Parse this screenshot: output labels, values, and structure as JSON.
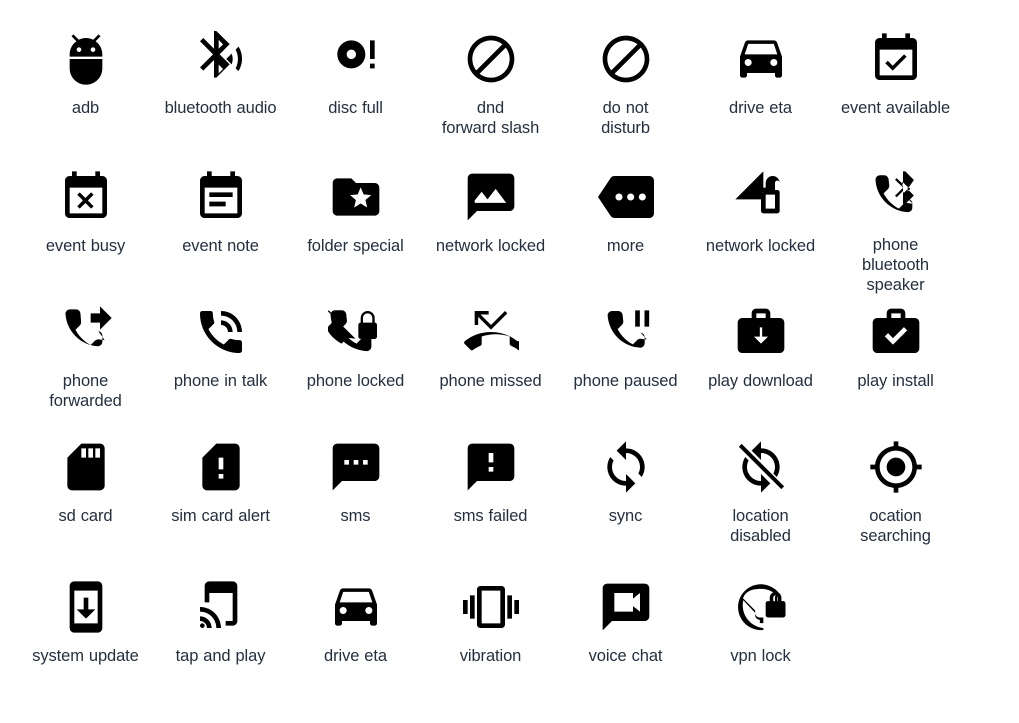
{
  "page": {
    "title": "Android Material Notification Icon Set",
    "background_color": "#ffffff",
    "icon_color": "#000000",
    "label_color": "#24303f",
    "columns": 7,
    "rows": 5,
    "total_icons": 34
  },
  "rows": [
    {
      "index": 0,
      "items": [
        {
          "icon": "adb-icon",
          "label": "adb"
        },
        {
          "icon": "bluetooth-audio-icon",
          "label": "bluetooth audio"
        },
        {
          "icon": "disc-full-icon",
          "label": "disc full"
        },
        {
          "icon": "dnd-forward-slash-icon",
          "label": "dnd\nforward slash"
        },
        {
          "icon": "do-not-disturb-icon",
          "label": "do not\ndisturb"
        },
        {
          "icon": "drive-eta-icon",
          "label": "drive eta"
        },
        {
          "icon": "event-available-icon",
          "label": "event available"
        }
      ]
    },
    {
      "index": 1,
      "items": [
        {
          "icon": "event-busy-icon",
          "label": "event busy"
        },
        {
          "icon": "event-note-icon",
          "label": "event note"
        },
        {
          "icon": "folder-special-icon",
          "label": "folder special"
        },
        {
          "icon": "network-locked-image-icon",
          "label": "network locked"
        },
        {
          "icon": "more-icon",
          "label": "more"
        },
        {
          "icon": "network-locked-signal-icon",
          "label": "network locked"
        },
        {
          "icon": "phone-bluetooth-speaker-icon",
          "label": "phone\nbluetooth\nspeaker"
        }
      ]
    },
    {
      "index": 2,
      "items": [
        {
          "icon": "phone-forwarded-icon",
          "label": "phone\nforwarded"
        },
        {
          "icon": "phone-in-talk-icon",
          "label": "phone in talk"
        },
        {
          "icon": "phone-locked-icon",
          "label": "phone locked"
        },
        {
          "icon": "phone-missed-icon",
          "label": "phone missed"
        },
        {
          "icon": "phone-paused-icon",
          "label": "phone paused"
        },
        {
          "icon": "play-download-icon",
          "label": "play download"
        },
        {
          "icon": "play-install-icon",
          "label": "play install"
        }
      ]
    },
    {
      "index": 3,
      "items": [
        {
          "icon": "sd-card-icon",
          "label": "sd card"
        },
        {
          "icon": "sim-card-alert-icon",
          "label": "sim card alert"
        },
        {
          "icon": "sms-icon",
          "label": "sms"
        },
        {
          "icon": "sms-failed-icon",
          "label": "sms failed"
        },
        {
          "icon": "sync-icon",
          "label": "sync"
        },
        {
          "icon": "location-disabled-icon",
          "label": "location\ndisabled"
        },
        {
          "icon": "location-searching-icon",
          "label": "ocation\nsearching"
        }
      ]
    },
    {
      "index": 4,
      "items": [
        {
          "icon": "system-update-icon",
          "label": "system update"
        },
        {
          "icon": "tap-and-play-icon",
          "label": "tap and play"
        },
        {
          "icon": "drive-eta-icon",
          "label": "drive eta"
        },
        {
          "icon": "vibration-icon",
          "label": "vibration"
        },
        {
          "icon": "voice-chat-icon",
          "label": "voice chat"
        },
        {
          "icon": "vpn-lock-icon",
          "label": "vpn lock"
        }
      ]
    }
  ]
}
